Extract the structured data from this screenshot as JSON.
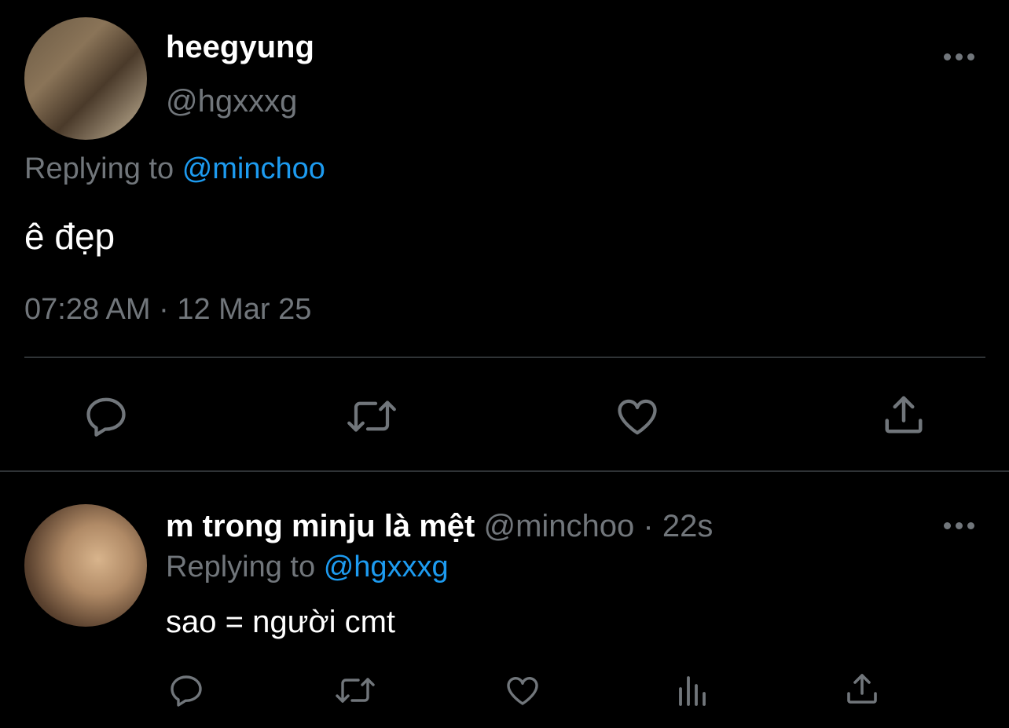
{
  "main_tweet": {
    "display_name": "heegyung",
    "handle": "@hgxxxg",
    "replying_prefix": "Replying to",
    "replying_to": "@minchoo",
    "text": "ê đẹp",
    "timestamp": "07:28 AM · 12 Mar 25",
    "actions": [
      "reply-icon",
      "retweet-icon",
      "like-icon",
      "share-icon"
    ]
  },
  "reply_tweet": {
    "display_name": "m trong minju là mệt",
    "handle": "@minchoo",
    "separator": "·",
    "time_ago": "22s",
    "replying_prefix": "Replying to",
    "replying_to": "@hgxxxg",
    "text": "sao = người cmt",
    "actions": [
      "reply-icon",
      "retweet-icon",
      "like-icon",
      "views-icon",
      "share-icon"
    ]
  },
  "colors": {
    "background": "#000000",
    "primary_text": "#ffffff",
    "secondary_text": "#71767b",
    "link": "#1d9bf0",
    "divider": "#2f3336"
  }
}
